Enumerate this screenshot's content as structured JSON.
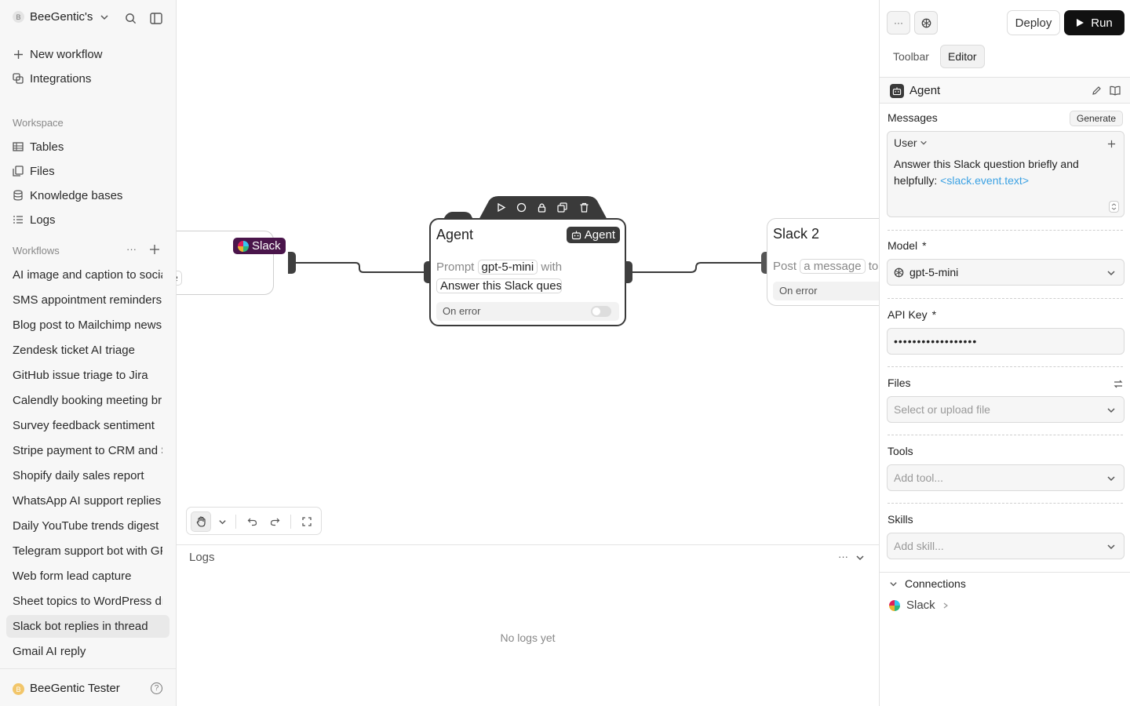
{
  "sidebar": {
    "workspace_badge": "B",
    "workspace_name": "BeeGentic's",
    "new_workflow": "New workflow",
    "integrations": "Integrations",
    "workspace_section": "Workspace",
    "workspace_items": [
      "Tables",
      "Files",
      "Knowledge bases",
      "Logs"
    ],
    "workflows_section": "Workflows",
    "workflows": [
      "AI image and caption to social",
      "SMS appointment reminders",
      "Blog post to Mailchimp newsletter",
      "Zendesk ticket AI triage",
      "GitHub issue triage to Jira",
      "Calendly booking meeting brief",
      "Survey feedback sentiment",
      "Stripe payment to CRM and Slack",
      "Shopify daily sales report",
      "WhatsApp AI support replies",
      "Daily YouTube trends digest",
      "Telegram support bot with GPT",
      "Web form lead capture",
      "Sheet topics to WordPress drafts",
      "Slack bot replies in thread",
      "Gmail AI reply"
    ],
    "active_workflow": "Slack bot replies in thread",
    "user_badge": "B",
    "user_name": "BeeGentic Tester",
    "help": "?"
  },
  "canvas": {
    "slack_node": {
      "tag": "Slack",
      "partial_text": "ge"
    },
    "agent_node": {
      "title": "Agent",
      "tag": "Agent",
      "prompt_word": "Prompt",
      "model_pill": "gpt-5-mini",
      "with_word": "with",
      "message_preview": "Answer this Slack question",
      "on_error": "On error"
    },
    "slack2_node": {
      "title": "Slack 2",
      "post_word": "Post",
      "message_pill": "a message",
      "to_word": "to",
      "on_error": "On error"
    }
  },
  "logs": {
    "title": "Logs",
    "empty": "No logs yet"
  },
  "right_panel": {
    "more_label": "···",
    "deploy": "Deploy",
    "run": "Run",
    "tabs": [
      "Toolbar",
      "Editor"
    ],
    "active_tab": "Editor",
    "block_title": "Agent",
    "messages_label": "Messages",
    "generate": "Generate",
    "role": "User",
    "message_text": "Answer this Slack question briefly and helpfully: ",
    "message_var": "<slack.event.text>",
    "model_label": "Model",
    "model_value": "gpt-5-mini",
    "api_key_label": "API Key",
    "api_key_value": "••••••••••••••••••",
    "required_mark": "*",
    "files_label": "Files",
    "files_placeholder": "Select or upload file",
    "tools_label": "Tools",
    "tools_placeholder": "Add tool...",
    "skills_label": "Skills",
    "skills_placeholder": "Add skill...",
    "connections_label": "Connections",
    "connection_item": "Slack"
  },
  "colors": {
    "slack_purple": "#4a154b",
    "link_blue": "#3ba1e3",
    "run_black": "#111111"
  }
}
